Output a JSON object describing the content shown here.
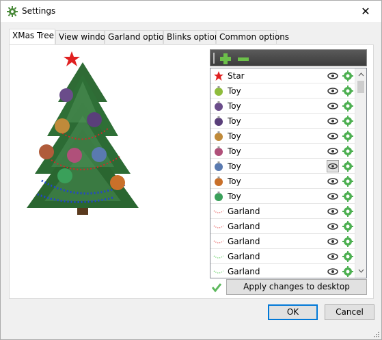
{
  "window": {
    "title": "Settings",
    "close_glyph": "✕"
  },
  "tabs": [
    {
      "label": "XMas Tree",
      "active": true
    },
    {
      "label": "View window"
    },
    {
      "label": "Garland options"
    },
    {
      "label": "Blinks options"
    },
    {
      "label": "Common options"
    }
  ],
  "list": {
    "items": [
      {
        "label": "Star",
        "icon": "star-icon"
      },
      {
        "label": "Toy",
        "icon": "toy-ball-icon",
        "color": "#8fbc3c"
      },
      {
        "label": "Toy",
        "icon": "toy-ball-icon",
        "color": "#6a4c8a"
      },
      {
        "label": "Toy",
        "icon": "toy-ball-icon",
        "color": "#5a3f7a"
      },
      {
        "label": "Toy",
        "icon": "toy-ball-icon",
        "color": "#c08a3a"
      },
      {
        "label": "Toy",
        "icon": "toy-ball-icon",
        "color": "#b0507a"
      },
      {
        "label": "Toy",
        "icon": "toy-ball-icon",
        "color": "#5a7ab0",
        "eye_pressed": true
      },
      {
        "label": "Toy",
        "icon": "toy-ball-icon",
        "color": "#c9702a"
      },
      {
        "label": "Toy",
        "icon": "toy-ball-icon",
        "color": "#3aa05a"
      },
      {
        "label": "Garland",
        "icon": "garland-icon",
        "color": "#e03030"
      },
      {
        "label": "Garland",
        "icon": "garland-icon",
        "color": "#e03030"
      },
      {
        "label": "Garland",
        "icon": "garland-icon",
        "color": "#e03030"
      },
      {
        "label": "Garland",
        "icon": "garland-icon",
        "color": "#30c030"
      },
      {
        "label": "Garland",
        "icon": "garland-icon",
        "color": "#30c030"
      }
    ]
  },
  "apply_label": "Apply changes to desktop",
  "buttons": {
    "ok": "OK",
    "cancel": "Cancel"
  },
  "colors": {
    "accent": "#0078d7",
    "toolbar": "#4a4a4a",
    "gear": "#4caf50"
  }
}
